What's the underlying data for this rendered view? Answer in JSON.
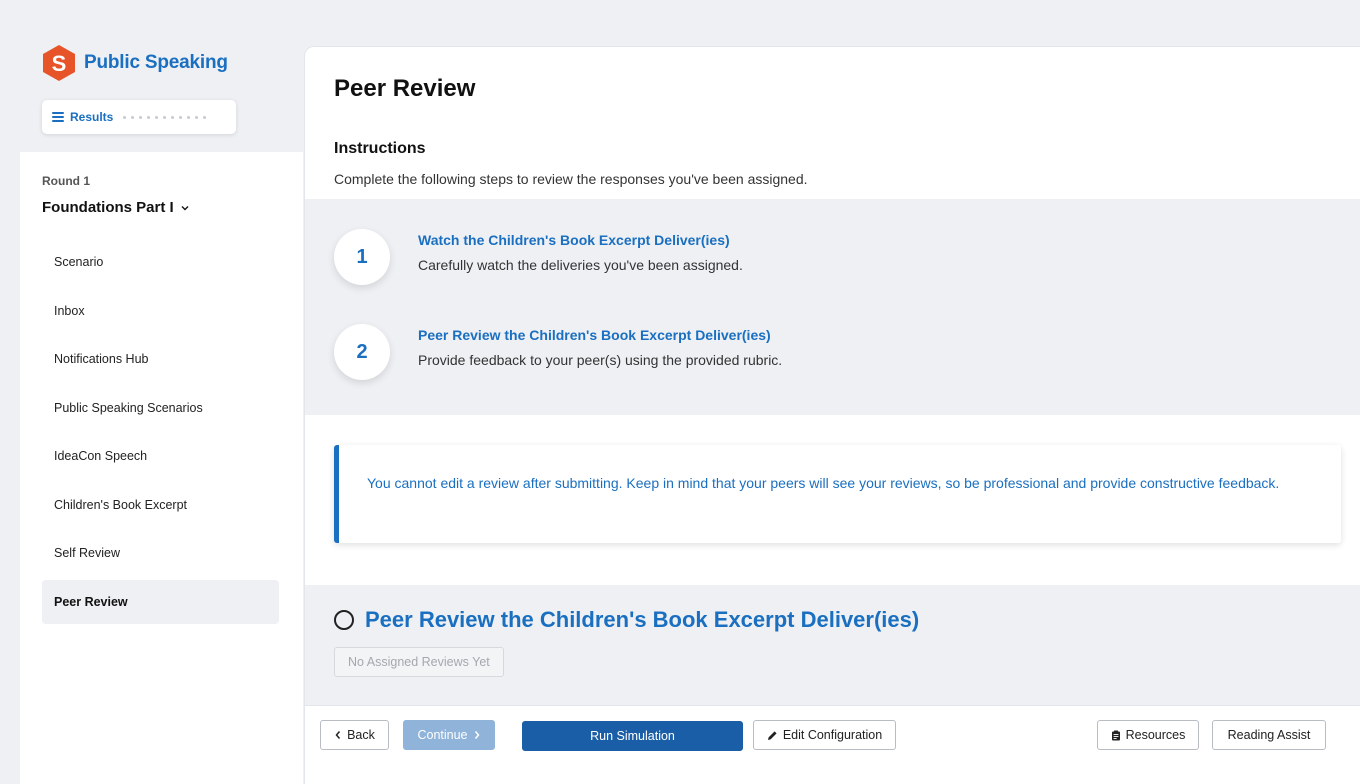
{
  "brand": {
    "name": "Public Speaking",
    "logo_letter": "S",
    "color": "#e8542a"
  },
  "results_pill": {
    "label": "Results",
    "icon": "hamburger-icon"
  },
  "sidebar": {
    "round_label": "Round 1",
    "round_title": "Foundations Part I",
    "items": [
      {
        "label": "Scenario",
        "active": false
      },
      {
        "label": "Inbox",
        "active": false
      },
      {
        "label": "Notifications Hub",
        "active": false
      },
      {
        "label": "Public Speaking Scenarios",
        "active": false
      },
      {
        "label": "IdeaCon Speech",
        "active": false
      },
      {
        "label": "Children's Book Excerpt",
        "active": false
      },
      {
        "label": "Self Review",
        "active": false
      },
      {
        "label": "Peer Review",
        "active": true
      }
    ]
  },
  "main": {
    "title": "Peer Review",
    "instructions_title": "Instructions",
    "instructions_text": "Complete the following steps to review the responses you've been assigned.",
    "steps": [
      {
        "number": "1",
        "title": "Watch the Children's Book Excerpt Deliver(ies)",
        "desc": "Carefully watch the deliveries you've been assigned."
      },
      {
        "number": "2",
        "title": "Peer Review the Children's Book Excerpt Deliver(ies)",
        "desc": "Provide feedback to your peer(s) using the provided rubric."
      }
    ],
    "notice": "You cannot edit a review after submitting. Keep in mind that your peers will see your reviews, so be professional and provide constructive feedback.",
    "review_section": {
      "title": "Peer Review the Children's Book Excerpt Deliver(ies)",
      "empty_button": "No Assigned Reviews Yet"
    }
  },
  "footer": {
    "back": "Back",
    "continue": "Continue",
    "run_simulation": "Run Simulation",
    "edit_configuration": "Edit Configuration",
    "resources": "Resources",
    "reading_assist": "Reading Assist"
  },
  "colors": {
    "accent": "#1a6fc0",
    "primary_button": "#1b5ea8",
    "disabled_button": "#8fb3d9",
    "background": "#eef0f4"
  }
}
